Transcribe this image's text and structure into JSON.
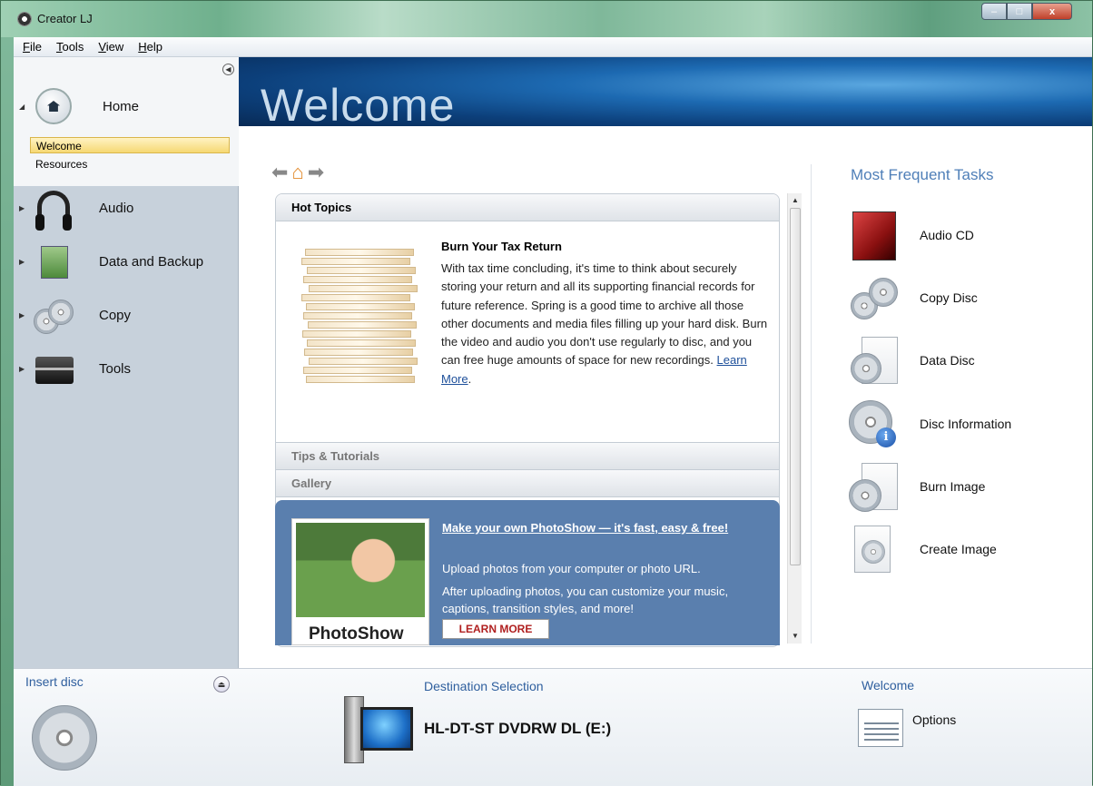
{
  "window": {
    "title": "Creator LJ",
    "controls": {
      "minimize": "–",
      "maximize": "□",
      "close": "x"
    }
  },
  "menu": [
    "File",
    "Tools",
    "View",
    "Help"
  ],
  "sidebar": {
    "collapse_icon": "chevron-left-icon",
    "sections": [
      {
        "label": "Home",
        "icon": "home-icon",
        "expanded": true,
        "children": [
          {
            "label": "Welcome",
            "selected": true
          },
          {
            "label": "Resources",
            "selected": false
          }
        ]
      },
      {
        "label": "Audio",
        "icon": "headphones-icon",
        "expanded": false
      },
      {
        "label": "Data and Backup",
        "icon": "data-backup-icon",
        "expanded": false
      },
      {
        "label": "Copy",
        "icon": "copy-discs-icon",
        "expanded": false
      },
      {
        "label": "Tools",
        "icon": "toolbox-icon",
        "expanded": false
      }
    ]
  },
  "banner": {
    "title": "Welcome"
  },
  "content": {
    "hot_topics": {
      "header": "Hot Topics",
      "article_title": "Burn Your Tax Return",
      "article_text": "With tax time concluding, it's time to think about securely storing your return and all its supporting financial records for future reference. Spring is a good time to archive all those other documents and media files filling up your hard disk. Burn the video and audio you don't use regularly to disc, and you can free huge amounts of space for new recordings.",
      "learn_more": "Learn More"
    },
    "tips_header": "Tips & Tutorials",
    "gallery_header": "Gallery",
    "promo": {
      "brand": "PhotoShow",
      "title": "Make your own PhotoShow — it's fast, easy & free!",
      "text1": "Upload photos from your computer or photo URL.",
      "text2": "After uploading photos, you can customize your music, captions, transition styles, and more!",
      "button": "LEARN MORE"
    }
  },
  "tasks": {
    "title": "Most Frequent Tasks",
    "items": [
      {
        "label": "Audio CD",
        "icon": "audio-cd-icon"
      },
      {
        "label": "Copy Disc",
        "icon": "copy-disc-icon"
      },
      {
        "label": "Data Disc",
        "icon": "data-disc-icon"
      },
      {
        "label": "Disc Information",
        "icon": "disc-info-icon"
      },
      {
        "label": "Burn Image",
        "icon": "burn-image-icon"
      },
      {
        "label": "Create Image",
        "icon": "create-image-icon"
      }
    ]
  },
  "bottom": {
    "insert_disc": "Insert disc",
    "destination_label": "Destination Selection",
    "drive_name": "HL-DT-ST DVDRW DL (E:)",
    "welcome_label": "Welcome",
    "options_label": "Options"
  },
  "colors": {
    "accent": "#4f7fb8",
    "banner": "#1d6ab2",
    "sidebar": "#c7d1db",
    "promo": "#5a7fae"
  }
}
